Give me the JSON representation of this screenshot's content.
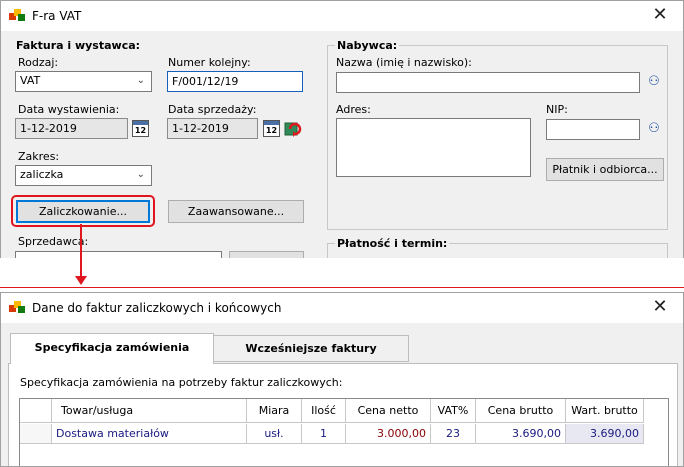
{
  "window1": {
    "title": "F-ra VAT",
    "close_glyph": "✕",
    "invoice_group": {
      "title": "Faktura i wystawca:",
      "rodzaj_label": "Rodzaj:",
      "rodzaj_value": "VAT",
      "numer_label": "Numer kolejny:",
      "numer_value": "F/001/12/19",
      "data_wyst_label": "Data wystawienia:",
      "data_wyst_value": "1-12-2019",
      "data_sprz_label": "Data sprzedaży:",
      "data_sprz_value": "1-12-2019",
      "calendar_text": "12",
      "zakres_label": "Zakres:",
      "zakres_value": "zaliczka",
      "zaliczkowanie_button": "Zaliczkowanie...",
      "zaawansowane_button": "Zaawansowane...",
      "sprzedawca_label": "Sprzedawca:"
    },
    "buyer_group": {
      "title": "Nabywca:",
      "nazwa_label": "Nazwa (imię i nazwisko):",
      "nazwa_value": "",
      "adres_label": "Adres:",
      "adres_value": "",
      "nip_label": "NIP:",
      "nip_value": "",
      "platnik_button": "Płatnik i odbiorca..."
    },
    "payment_group": {
      "title": "Płatność i termin:"
    }
  },
  "window2": {
    "title": "Dane do faktur zaliczkowych i końcowych",
    "close_glyph": "✕",
    "tabs": [
      {
        "label": "Specyfikacja zamówienia"
      },
      {
        "label": "Wcześniejsze faktury"
      }
    ],
    "description": "Specyfikacja zamówienia na potrzeby faktur zaliczkowych:",
    "table": {
      "headers": [
        "Towar/usługa",
        "Miara",
        "Ilość",
        "Cena netto",
        "VAT%",
        "Cena brutto",
        "Wart. brutto"
      ],
      "rows": [
        [
          "Dostawa materiałów",
          "usł.",
          "1",
          "3.000,00",
          "23",
          "3.690,00",
          "3.690,00"
        ]
      ]
    }
  },
  "colors": {
    "highlight_red": "#e0161e",
    "accent_blue": "#0078d7",
    "text_navy": "#1a1a80",
    "text_maroon": "#8b0000"
  }
}
